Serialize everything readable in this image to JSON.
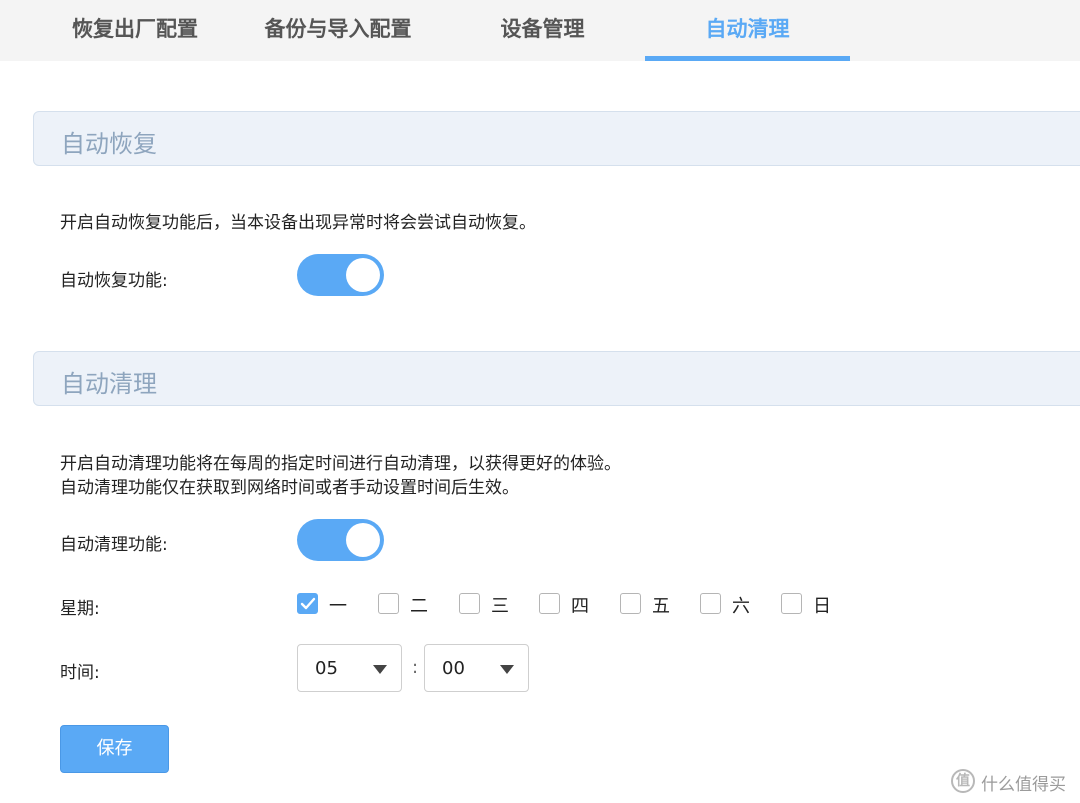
{
  "tabs": [
    {
      "label": "恢复出厂配置",
      "active": false
    },
    {
      "label": "备份与导入配置",
      "active": false
    },
    {
      "label": "设备管理",
      "active": false
    },
    {
      "label": "自动清理",
      "active": true
    }
  ],
  "auto_recover": {
    "title": "自动恢复",
    "description": "开启自动恢复功能后，当本设备出现异常时将会尝试自动恢复。",
    "toggle_label": "自动恢复功能:",
    "enabled": true
  },
  "auto_clean": {
    "title": "自动清理",
    "description_line1": "开启自动清理功能将在每周的指定时间进行自动清理，以获得更好的体验。",
    "description_line2": "自动清理功能仅在获取到网络时间或者手动设置时间后生效。",
    "toggle_label": "自动清理功能:",
    "enabled": true,
    "weekday_label": "星期:",
    "weekdays": [
      {
        "label": "一",
        "checked": true
      },
      {
        "label": "二",
        "checked": false
      },
      {
        "label": "三",
        "checked": false
      },
      {
        "label": "四",
        "checked": false
      },
      {
        "label": "五",
        "checked": false
      },
      {
        "label": "六",
        "checked": false
      },
      {
        "label": "日",
        "checked": false
      }
    ],
    "time_label": "时间:",
    "hour": "05",
    "minute": "00",
    "time_separator": ":"
  },
  "save_label": "保存",
  "watermark": "什么值得买",
  "colors": {
    "accent": "#5aa9f5",
    "section_bg": "#edf2f9",
    "section_title": "#8ea5be"
  }
}
